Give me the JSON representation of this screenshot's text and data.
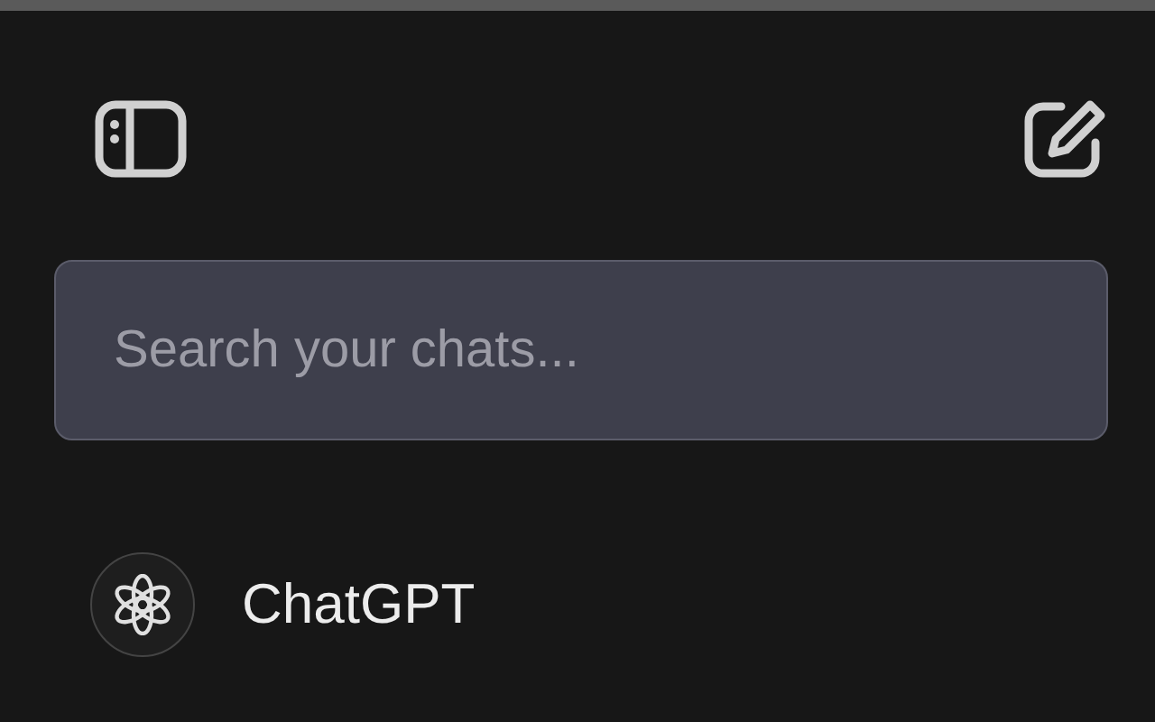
{
  "search": {
    "placeholder": "Search your chats..."
  },
  "chats": [
    {
      "label": "ChatGPT"
    }
  ]
}
